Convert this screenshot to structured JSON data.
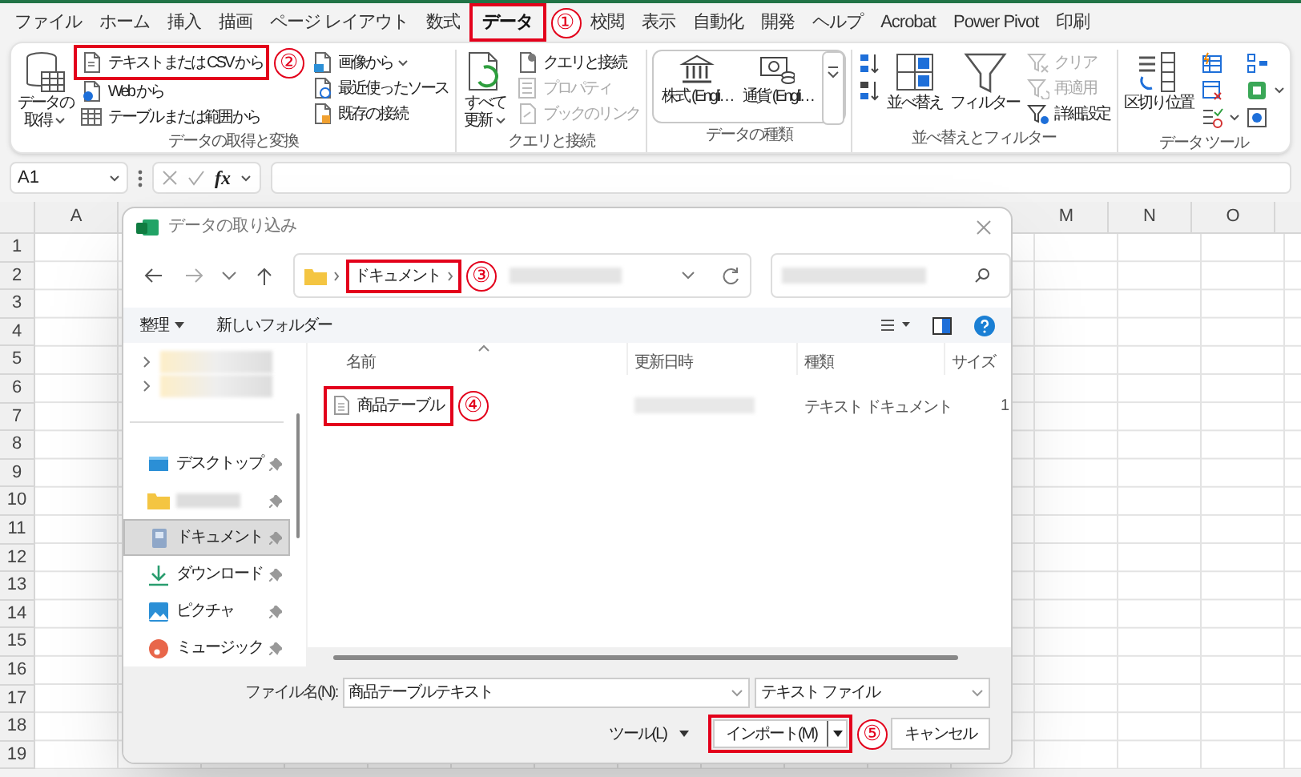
{
  "app_tabs": [
    {
      "label": "ファイル",
      "selected": false
    },
    {
      "label": "ホーム",
      "selected": false
    },
    {
      "label": "挿入",
      "selected": false
    },
    {
      "label": "描画",
      "selected": false
    },
    {
      "label": "ページ レイアウト",
      "selected": false
    },
    {
      "label": "数式",
      "selected": false
    },
    {
      "label": "データ",
      "selected": true,
      "highlighted": true,
      "callout": "①"
    },
    {
      "label": "校閲",
      "selected": false
    },
    {
      "label": "表示",
      "selected": false
    },
    {
      "label": "自動化",
      "selected": false
    },
    {
      "label": "開発",
      "selected": false
    },
    {
      "label": "ヘルプ",
      "selected": false
    },
    {
      "label": "Acrobat",
      "selected": false
    },
    {
      "label": "Power Pivot",
      "selected": false
    },
    {
      "label": "印刷",
      "selected": false
    }
  ],
  "ribbon": {
    "groups": [
      {
        "label": "データの取得と変換",
        "columns": [
          [
            {
              "kind": "large",
              "lines": [
                "データの",
                "取得"
              ],
              "dropdown": true
            }
          ],
          [
            {
              "kind": "small",
              "label": "テキストまたは CSV から",
              "disabled": false,
              "highlighted": true,
              "callout": "②"
            },
            {
              "kind": "small",
              "label": "Web から",
              "disabled": false
            },
            {
              "kind": "small",
              "label": "テーブルまたは範囲から",
              "disabled": false
            }
          ],
          [
            {
              "kind": "small",
              "label": "画像から",
              "disabled": false,
              "dropdown": true
            },
            {
              "kind": "small",
              "label": "最近使ったソース",
              "disabled": false
            },
            {
              "kind": "small",
              "label": "既存の接続",
              "disabled": false
            }
          ]
        ]
      },
      {
        "label": "クエリと接続",
        "columns": [
          [
            {
              "kind": "large",
              "lines": [
                "すべて",
                "更新"
              ],
              "dropdown": true
            }
          ],
          [
            {
              "kind": "small",
              "label": "クエリと接続",
              "disabled": false
            },
            {
              "kind": "small",
              "label": "プロパティ",
              "disabled": true
            },
            {
              "kind": "small",
              "label": "ブックのリンク",
              "disabled": true
            }
          ]
        ]
      },
      {
        "label": "データの種類",
        "columns": [
          [
            {
              "kind": "gallery",
              "label": "株式 (Engli…"
            }
          ],
          [
            {
              "kind": "gallery",
              "label": "通貨 (Engli…"
            }
          ],
          [
            {
              "kind": "more"
            }
          ]
        ]
      },
      {
        "label": "並べ替えとフィルター",
        "columns": [
          [
            {
              "kind": "icon"
            },
            {
              "kind": "icon"
            }
          ],
          [
            {
              "kind": "large",
              "lines": [
                "並べ替え"
              ]
            }
          ],
          [
            {
              "kind": "large",
              "lines": [
                "フィルター"
              ]
            }
          ],
          [
            {
              "kind": "small",
              "label": "クリア",
              "disabled": true
            },
            {
              "kind": "small",
              "label": "再適用",
              "disabled": true
            },
            {
              "kind": "small",
              "label": "詳細設定",
              "disabled": false
            }
          ]
        ]
      },
      {
        "label": "データ ツール",
        "columns": [
          [
            {
              "kind": "large",
              "lines": [
                "区切り位置"
              ]
            }
          ],
          [
            {
              "kind": "icon"
            },
            {
              "kind": "icon"
            },
            {
              "kind": "icon",
              "dropdown": true
            }
          ],
          [
            {
              "kind": "icon"
            },
            {
              "kind": "icon",
              "dropdown": true
            },
            {
              "kind": "icon"
            }
          ]
        ]
      }
    ]
  },
  "formula_bar": {
    "name_box": "A1",
    "function_label": "fx"
  },
  "sheet": {
    "column_headers": [
      "A",
      "M",
      "N",
      "O"
    ],
    "row_headers": [
      "1",
      "2",
      "3",
      "4",
      "5",
      "6",
      "7",
      "8",
      "9",
      "10",
      "11",
      "12",
      "13",
      "14",
      "15",
      "16",
      "17",
      "18",
      "19"
    ]
  },
  "dialog": {
    "title": "データの取り込み",
    "address": {
      "folder": "ドキュメント",
      "highlighted": true,
      "callout": "③"
    },
    "toolbar": {
      "organize": "整理",
      "new_folder": "新しいフォルダー"
    },
    "nav_top": [
      {
        "kind": "redacted",
        "expanded": false
      },
      {
        "kind": "redacted",
        "expanded": false
      }
    ],
    "quick_access": [
      {
        "kind": "desktop",
        "label": "デスクトップ",
        "pinned": true,
        "selected": false
      },
      {
        "kind": "folder",
        "pinned": true,
        "selected": false
      },
      {
        "kind": "documents",
        "label": "ドキュメント",
        "pinned": true,
        "selected": true
      },
      {
        "kind": "downloads",
        "label": "ダウンロード",
        "pinned": true,
        "selected": false
      },
      {
        "kind": "pictures",
        "label": "ピクチャ",
        "pinned": true,
        "selected": false
      },
      {
        "kind": "music",
        "label": "ミュージック",
        "pinned": true,
        "selected": false
      }
    ],
    "columns": [
      "名前",
      "更新日時",
      "種類",
      "サイズ"
    ],
    "files": [
      {
        "name": "商品テーブル",
        "type": "テキスト ドキュメント",
        "size": "1",
        "selected": false,
        "highlighted": true,
        "callout": "④"
      }
    ],
    "file_name_label": "ファイル名(N):",
    "file_name": "商品テーブルテキスト",
    "file_type": "テキスト ファイル",
    "tools": "ツール(L)",
    "import_button": {
      "label": "インポート(M)",
      "highlighted": true,
      "callout": "⑤"
    },
    "cancel": "キャンセル"
  }
}
